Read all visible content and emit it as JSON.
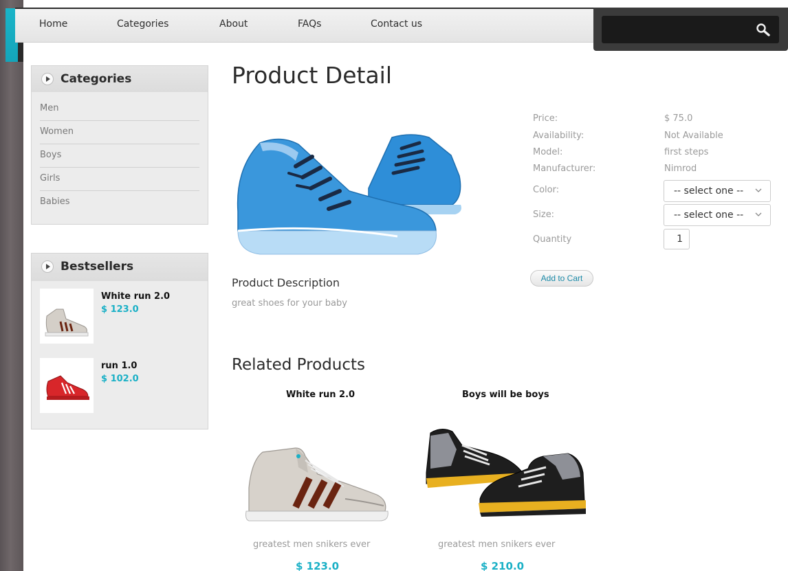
{
  "nav": {
    "items": [
      "Home",
      "Categories",
      "About",
      "FAQs",
      "Contact us"
    ]
  },
  "search": {
    "placeholder": "",
    "icon": "search-icon"
  },
  "sidebar": {
    "categories": {
      "title": "Categories",
      "items": [
        "Men",
        "Women",
        "Boys",
        "Girls",
        "Babies"
      ]
    },
    "bestsellers": {
      "title": "Bestsellers",
      "items": [
        {
          "name": "White run 2.0",
          "price": "$ 123.0"
        },
        {
          "name": "run 1.0",
          "price": "$ 102.0"
        }
      ]
    }
  },
  "product": {
    "page_title": "Product Detail",
    "description_title": "Product Description",
    "description": "great shoes for your baby",
    "specs": {
      "price_label": "Price:",
      "price": "$ 75.0",
      "availability_label": "Availability:",
      "availability": "Not Available",
      "model_label": "Model:",
      "model": "first steps",
      "manufacturer_label": "Manufacturer:",
      "manufacturer": "Nimrod",
      "color_label": "Color:",
      "color_selected": "-- select one --",
      "size_label": "Size:",
      "size_selected": "-- select one --",
      "quantity_label": "Quantity",
      "quantity": "1"
    },
    "add_to_cart": "Add to Cart"
  },
  "related": {
    "title": "Related Products",
    "items": [
      {
        "name": "White run 2.0",
        "description": "greatest men snikers ever",
        "price": "$ 123.0"
      },
      {
        "name": "Boys will be boys",
        "description": "greatest men snikers ever",
        "price": "$ 210.0"
      }
    ]
  },
  "colors": {
    "accent": "#1ab0c6",
    "teal_tab": "#1ab4c8",
    "search_bg": "#3b3b3b"
  }
}
